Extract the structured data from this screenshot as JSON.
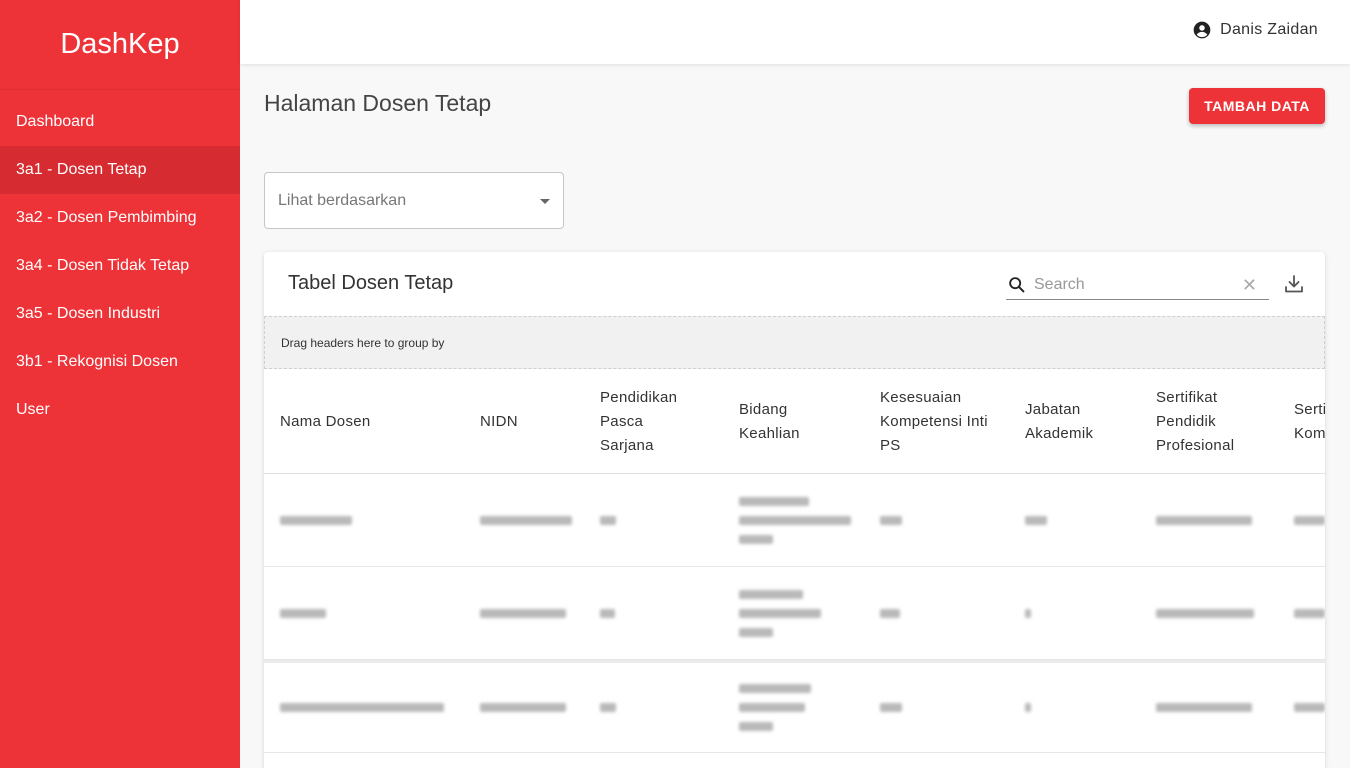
{
  "brand": "DashKep",
  "sidebar": {
    "items": [
      {
        "label": "Dashboard"
      },
      {
        "label": "3a1 - Dosen Tetap"
      },
      {
        "label": "3a2 - Dosen Pembimbing"
      },
      {
        "label": "3a4 - Dosen Tidak Tetap"
      },
      {
        "label": "3a5 - Dosen Industri"
      },
      {
        "label": "3b1 - Rekognisi Dosen"
      },
      {
        "label": "User"
      }
    ],
    "active_index": 1
  },
  "header": {
    "user_name": "Danis Zaidan",
    "user_icon": "account-circle-icon"
  },
  "page": {
    "title": "Halaman Dosen Tetap",
    "add_button": "TAMBAH DATA",
    "filter_placeholder": "Lihat berdasarkan"
  },
  "table": {
    "title": "Tabel Dosen Tetap",
    "search_placeholder": "Search",
    "group_hint": "Drag headers here to group by",
    "columns": [
      {
        "label": "Nama Dosen"
      },
      {
        "label": "NIDN"
      },
      {
        "label": "Pendidikan Pasca Sarjana"
      },
      {
        "label": "Bidang Keahlian"
      },
      {
        "label": "Kesesuaian Kompetensi Inti PS"
      },
      {
        "label": "Jabatan Akademik"
      },
      {
        "label": "Sertifikat Pendidik Profesional"
      },
      {
        "label": "Serti Kom"
      }
    ],
    "rows_note": "row values are blurred/unreadable in the screenshot"
  },
  "colors": {
    "accent": "#ee3338",
    "sidebar_active": "#d62b30"
  }
}
